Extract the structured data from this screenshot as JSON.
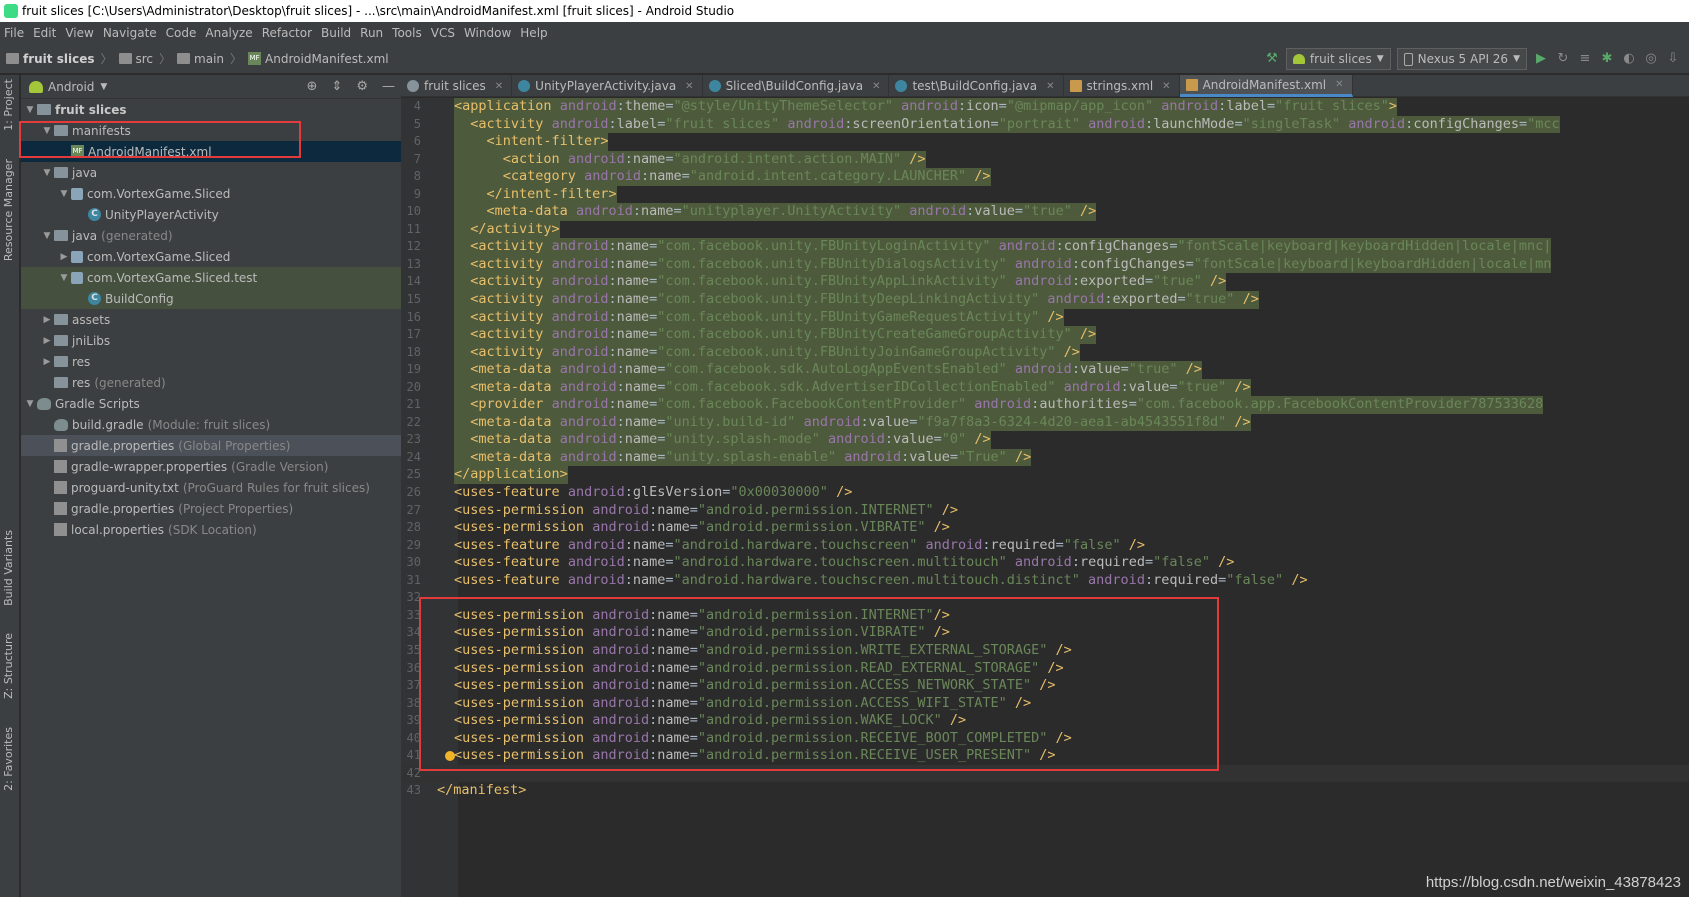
{
  "window_title": "fruit slices [C:\\Users\\Administrator\\Desktop\\fruit slices] - ...\\src\\main\\AndroidManifest.xml [fruit slices] - Android Studio",
  "menu": [
    "File",
    "Edit",
    "View",
    "Navigate",
    "Code",
    "Analyze",
    "Refactor",
    "Build",
    "Run",
    "Tools",
    "VCS",
    "Window",
    "Help"
  ],
  "breadcrumb": [
    "fruit slices",
    "src",
    "main",
    "AndroidManifest.xml"
  ],
  "run_config": "fruit slices",
  "device": "Nexus 5 API 26",
  "left_tabs": {
    "project": "1: Project",
    "resource_manager": "Resource Manager",
    "build_variants": "Build Variants",
    "structure": "Z: Structure",
    "favorites": "2: Favorites"
  },
  "project_view": "Android",
  "tree": [
    {
      "label": "fruit slices",
      "indent": 0,
      "icon": "module",
      "arrow": "down",
      "bold": true
    },
    {
      "label": "manifests",
      "indent": 1,
      "icon": "folder",
      "arrow": "down"
    },
    {
      "label": "AndroidManifest.xml",
      "indent": 2,
      "icon": "xml",
      "arrow": "none",
      "selected": true
    },
    {
      "label": "java",
      "indent": 1,
      "icon": "folder",
      "arrow": "down"
    },
    {
      "label": "com.VortexGame.Sliced",
      "indent": 2,
      "icon": "package",
      "arrow": "down"
    },
    {
      "label": "UnityPlayerActivity",
      "indent": 3,
      "icon": "class",
      "arrow": "none"
    },
    {
      "label": "java",
      "hint": "(generated)",
      "indent": 1,
      "icon": "folder",
      "arrow": "down"
    },
    {
      "label": "com.VortexGame.Sliced",
      "indent": 2,
      "icon": "package",
      "arrow": "right"
    },
    {
      "label": "com.VortexGame.Sliced.test",
      "indent": 2,
      "icon": "package",
      "arrow": "down",
      "highlight": "green"
    },
    {
      "label": "BuildConfig",
      "indent": 3,
      "icon": "class",
      "arrow": "none",
      "highlight": "green"
    },
    {
      "label": "assets",
      "indent": 1,
      "icon": "folder",
      "arrow": "right"
    },
    {
      "label": "jniLibs",
      "indent": 1,
      "icon": "folder",
      "arrow": "right"
    },
    {
      "label": "res",
      "indent": 1,
      "icon": "folder",
      "arrow": "right"
    },
    {
      "label": "res",
      "hint": "(generated)",
      "indent": 1,
      "icon": "folder",
      "arrow": "none"
    },
    {
      "label": "Gradle Scripts",
      "indent": 0,
      "icon": "gradle",
      "arrow": "down"
    },
    {
      "label": "build.gradle",
      "hint": "(Module: fruit slices)",
      "indent": 1,
      "icon": "gradle",
      "arrow": "none"
    },
    {
      "label": "gradle.properties",
      "hint": "(Global Properties)",
      "indent": 1,
      "icon": "prop",
      "arrow": "none",
      "highlight": "gray"
    },
    {
      "label": "gradle-wrapper.properties",
      "hint": "(Gradle Version)",
      "indent": 1,
      "icon": "prop",
      "arrow": "none"
    },
    {
      "label": "proguard-unity.txt",
      "hint": "(ProGuard Rules for fruit slices)",
      "indent": 1,
      "icon": "prop",
      "arrow": "none"
    },
    {
      "label": "gradle.properties",
      "hint": "(Project Properties)",
      "indent": 1,
      "icon": "prop",
      "arrow": "none"
    },
    {
      "label": "local.properties",
      "hint": "(SDK Location)",
      "indent": 1,
      "icon": "prop",
      "arrow": "none"
    }
  ],
  "tabs": [
    {
      "label": "fruit slices",
      "icon": "module"
    },
    {
      "label": "UnityPlayerActivity.java",
      "icon": "class"
    },
    {
      "label": "Sliced\\BuildConfig.java",
      "icon": "class"
    },
    {
      "label": "test\\BuildConfig.java",
      "icon": "class"
    },
    {
      "label": "strings.xml",
      "icon": "xml"
    },
    {
      "label": "AndroidManifest.xml",
      "icon": "xml",
      "active": true
    }
  ],
  "code": [
    {
      "n": "4",
      "sel": true,
      "t": "<application android:theme=\"@style/UnityThemeSelector\" android:icon=\"@mipmap/app_icon\" android:label=\"fruit slices\">"
    },
    {
      "n": "5",
      "sel": true,
      "t": "  <activity android:label=\"fruit slices\" android:screenOrientation=\"portrait\" android:launchMode=\"singleTask\" android:configChanges=\"mcc"
    },
    {
      "n": "6",
      "sel": true,
      "t": "    <intent-filter>"
    },
    {
      "n": "7",
      "sel": true,
      "t": "      <action android:name=\"android.intent.action.MAIN\" />"
    },
    {
      "n": "8",
      "sel": true,
      "t": "      <category android:name=\"android.intent.category.LAUNCHER\" />"
    },
    {
      "n": "9",
      "sel": true,
      "t": "    </intent-filter>"
    },
    {
      "n": "10",
      "sel": true,
      "t": "    <meta-data android:name=\"unityplayer.UnityActivity\" android:value=\"true\" />"
    },
    {
      "n": "11",
      "sel": true,
      "t": "  </activity>"
    },
    {
      "n": "12",
      "sel": true,
      "t": "  <activity android:name=\"com.facebook.unity.FBUnityLoginActivity\" android:configChanges=\"fontScale|keyboard|keyboardHidden|locale|mnc|"
    },
    {
      "n": "13",
      "sel": true,
      "t": "  <activity android:name=\"com.facebook.unity.FBUnityDialogsActivity\" android:configChanges=\"fontScale|keyboard|keyboardHidden|locale|mn"
    },
    {
      "n": "14",
      "sel": true,
      "t": "  <activity android:name=\"com.facebook.unity.FBUnityAppLinkActivity\" android:exported=\"true\" />"
    },
    {
      "n": "15",
      "sel": true,
      "t": "  <activity android:name=\"com.facebook.unity.FBUnityDeepLinkingActivity\" android:exported=\"true\" />"
    },
    {
      "n": "16",
      "sel": true,
      "t": "  <activity android:name=\"com.facebook.unity.FBUnityGameRequestActivity\" />"
    },
    {
      "n": "17",
      "sel": true,
      "t": "  <activity android:name=\"com.facebook.unity.FBUnityCreateGameGroupActivity\" />"
    },
    {
      "n": "18",
      "sel": true,
      "t": "  <activity android:name=\"com.facebook.unity.FBUnityJoinGameGroupActivity\" />"
    },
    {
      "n": "19",
      "sel": true,
      "t": "  <meta-data android:name=\"com.facebook.sdk.AutoLogAppEventsEnabled\" android:value=\"true\" />"
    },
    {
      "n": "20",
      "sel": true,
      "t": "  <meta-data android:name=\"com.facebook.sdk.AdvertiserIDCollectionEnabled\" android:value=\"true\" />"
    },
    {
      "n": "21",
      "sel": true,
      "t": "  <provider android:name=\"com.facebook.FacebookContentProvider\" android:authorities=\"com.facebook.app.FacebookContentProvider787533628"
    },
    {
      "n": "22",
      "sel": true,
      "t": "  <meta-data android:name=\"unity.build-id\" android:value=\"f9a7f8a3-6324-4d20-aea1-ab4543551f8d\" />"
    },
    {
      "n": "23",
      "sel": true,
      "t": "  <meta-data android:name=\"unity.splash-mode\" android:value=\"0\" />"
    },
    {
      "n": "24",
      "sel": true,
      "t": "  <meta-data android:name=\"unity.splash-enable\" android:value=\"True\" />"
    },
    {
      "n": "25",
      "sel": true,
      "t": "</application>"
    },
    {
      "n": "26",
      "t": "<uses-feature android:glEsVersion=\"0x00030000\" />"
    },
    {
      "n": "27",
      "t": "<uses-permission android:name=\"android.permission.INTERNET\" />"
    },
    {
      "n": "28",
      "t": "<uses-permission android:name=\"android.permission.VIBRATE\" />"
    },
    {
      "n": "29",
      "t": "<uses-feature android:name=\"android.hardware.touchscreen\" android:required=\"false\" />"
    },
    {
      "n": "30",
      "t": "<uses-feature android:name=\"android.hardware.touchscreen.multitouch\" android:required=\"false\" />"
    },
    {
      "n": "31",
      "t": "<uses-feature android:name=\"android.hardware.touchscreen.multitouch.distinct\" android:required=\"false\" />"
    },
    {
      "n": "32",
      "t": ""
    },
    {
      "n": "33",
      "t": "<uses-permission android:name=\"android.permission.INTERNET\"/>"
    },
    {
      "n": "34",
      "t": "<uses-permission android:name=\"android.permission.VIBRATE\" />"
    },
    {
      "n": "35",
      "t": "<uses-permission android:name=\"android.permission.WRITE_EXTERNAL_STORAGE\" />"
    },
    {
      "n": "36",
      "t": "<uses-permission android:name=\"android.permission.READ_EXTERNAL_STORAGE\" />"
    },
    {
      "n": "37",
      "t": "<uses-permission android:name=\"android.permission.ACCESS_NETWORK_STATE\" />"
    },
    {
      "n": "38",
      "t": "<uses-permission android:name=\"android.permission.ACCESS_WIFI_STATE\" />"
    },
    {
      "n": "39",
      "t": "<uses-permission android:name=\"android.permission.WAKE_LOCK\" />"
    },
    {
      "n": "40",
      "t": "<uses-permission android:name=\"android.permission.RECEIVE_BOOT_COMPLETED\" />"
    },
    {
      "n": "41",
      "t": "<uses-permission android:name=\"android.permission.RECEIVE_USER_PRESENT\" />",
      "bulb": true
    },
    {
      "n": "42",
      "t": "",
      "caret": true
    },
    {
      "n": "43",
      "t": "</manifest>",
      "outdent": true
    }
  ],
  "watermark": "https://blog.csdn.net/weixin_43878423",
  "colors": {
    "tag": "#e8bf6a",
    "attr": "#bababa",
    "ns": "#9876aa",
    "value": "#6a8759",
    "highlight_box": "#e33b3b"
  }
}
